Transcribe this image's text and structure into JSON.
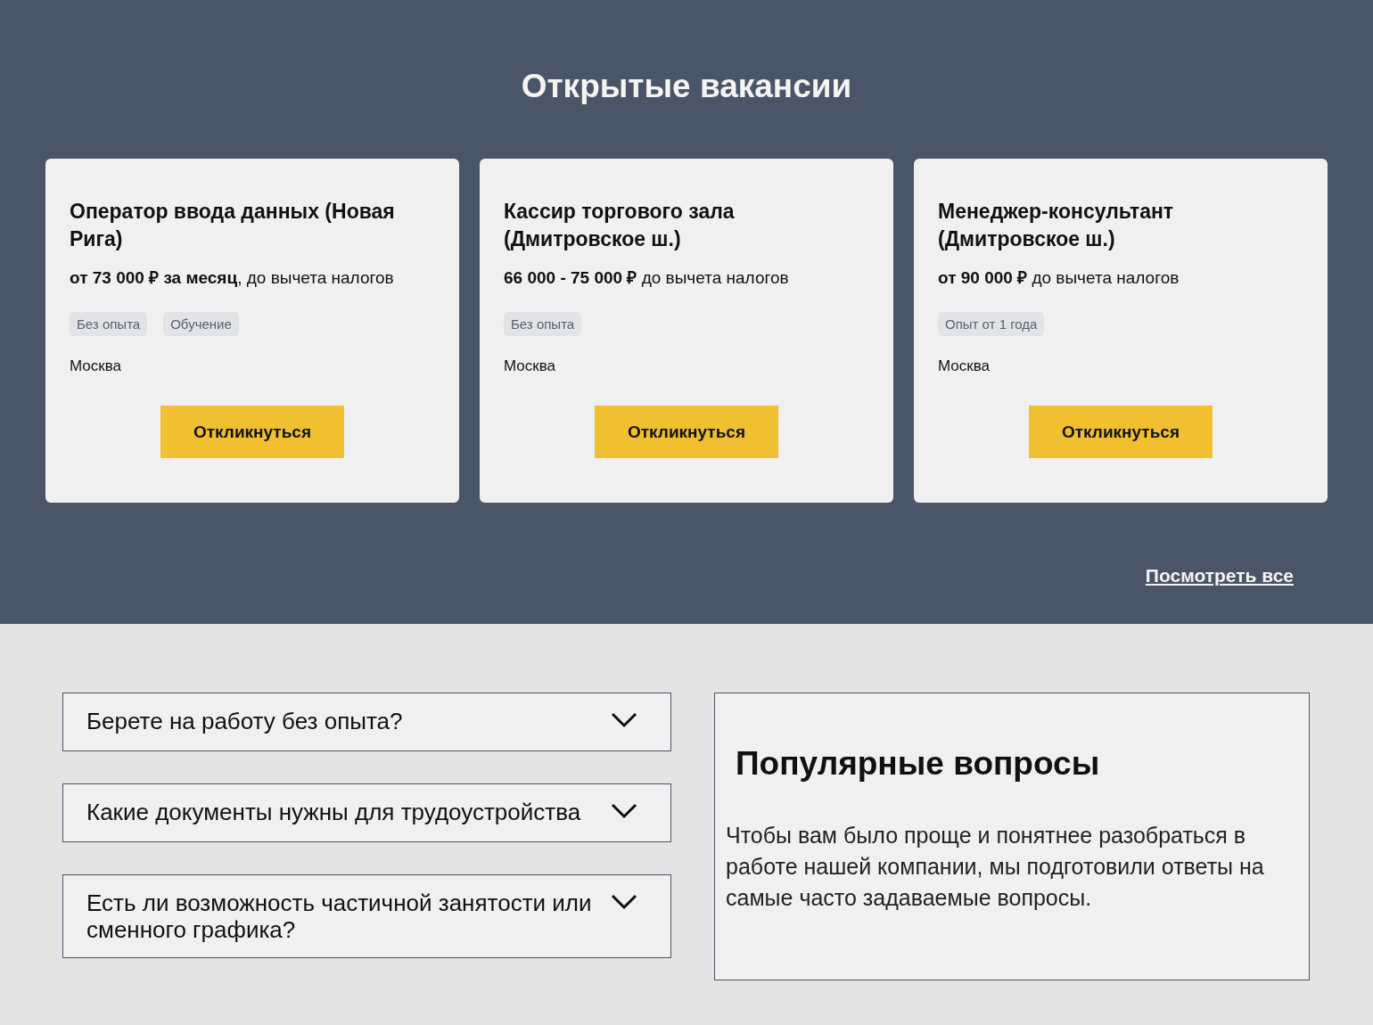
{
  "vacancies": {
    "title": "Открытые вакансии",
    "cards": [
      {
        "title": "Оператор ввода данных (Новая Рига)",
        "salary": "**от 73 000 ₽ за месяц**, до вычета налогов",
        "tags": [
          "Без опыта",
          "Обучение"
        ],
        "city": "Москва",
        "button": "Откликнуться"
      },
      {
        "title": "Кассир торгового зала (Дмитровское ш.)",
        "salary": "**66 000 - 75 000 ₽** до вычета налогов",
        "tags": [
          "Без опыта"
        ],
        "city": "Москва",
        "button": "Откликнуться"
      },
      {
        "title": "Менеджер-консультант (Дмитровское ш.)",
        "salary": "**от 90 000 ₽** до вычета налогов",
        "tags": [
          "Опыт от 1 года"
        ],
        "city": "Москва",
        "button": "Откликнуться"
      }
    ],
    "view_all": "Посмотреть все"
  },
  "faq": {
    "items": [
      {
        "question": "Берете на работу без опыта?",
        "expanded": false
      },
      {
        "question": "Какие документы нужны для трудоустройства",
        "expanded": false
      },
      {
        "question": "Есть ли возможность частичной занятости или сменного графика?",
        "expanded": false
      }
    ],
    "panel": {
      "title": "Популярные вопросы",
      "text": "Чтобы вам было проще и понятнее разобраться в работе нашей компании, мы подготовили ответы на самые часто задаваемые вопросы."
    }
  }
}
